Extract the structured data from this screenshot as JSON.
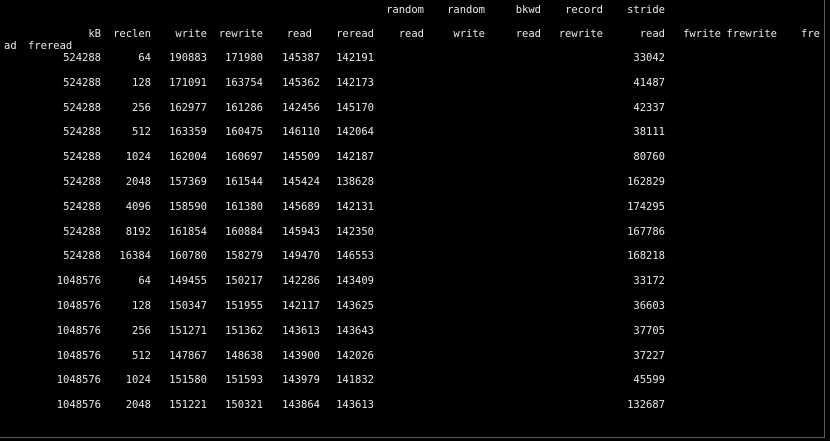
{
  "terminal": {
    "header_row1": [
      "random",
      "random",
      "bkwd",
      "record",
      "stride"
    ],
    "header_row2": [
      "kB",
      "reclen",
      "write",
      "rewrite",
      "read",
      "reread",
      "read",
      "write",
      "read",
      "rewrite",
      "read",
      "fwrite",
      "frewrite",
      "fre"
    ],
    "header_row3": [
      "ad",
      "freread"
    ],
    "rows": [
      [
        "524288",
        "64",
        "190883",
        "171980",
        "145387",
        "142191",
        "33042"
      ],
      [
        "524288",
        "128",
        "171091",
        "163754",
        "145362",
        "142173",
        "41487"
      ],
      [
        "524288",
        "256",
        "162977",
        "161286",
        "142456",
        "145170",
        "42337"
      ],
      [
        "524288",
        "512",
        "163359",
        "160475",
        "146110",
        "142064",
        "38111"
      ],
      [
        "524288",
        "1024",
        "162004",
        "160697",
        "145509",
        "142187",
        "80760"
      ],
      [
        "524288",
        "2048",
        "157369",
        "161544",
        "145424",
        "138628",
        "162829"
      ],
      [
        "524288",
        "4096",
        "158590",
        "161380",
        "145689",
        "142131",
        "174295"
      ],
      [
        "524288",
        "8192",
        "161854",
        "160884",
        "145943",
        "142350",
        "167786"
      ],
      [
        "524288",
        "16384",
        "160780",
        "158279",
        "149470",
        "146553",
        "168218"
      ],
      [
        "1048576",
        "64",
        "149455",
        "150217",
        "142286",
        "143409",
        "33172"
      ],
      [
        "1048576",
        "128",
        "150347",
        "151955",
        "142117",
        "143625",
        "36603"
      ],
      [
        "1048576",
        "256",
        "151271",
        "151362",
        "143613",
        "143643",
        "37705"
      ],
      [
        "1048576",
        "512",
        "147867",
        "148638",
        "143900",
        "142026",
        "37227"
      ],
      [
        "1048576",
        "1024",
        "151580",
        "151593",
        "143979",
        "141832",
        "45599"
      ],
      [
        "1048576",
        "2048",
        "151221",
        "150321",
        "143864",
        "143613",
        "132687"
      ]
    ]
  }
}
